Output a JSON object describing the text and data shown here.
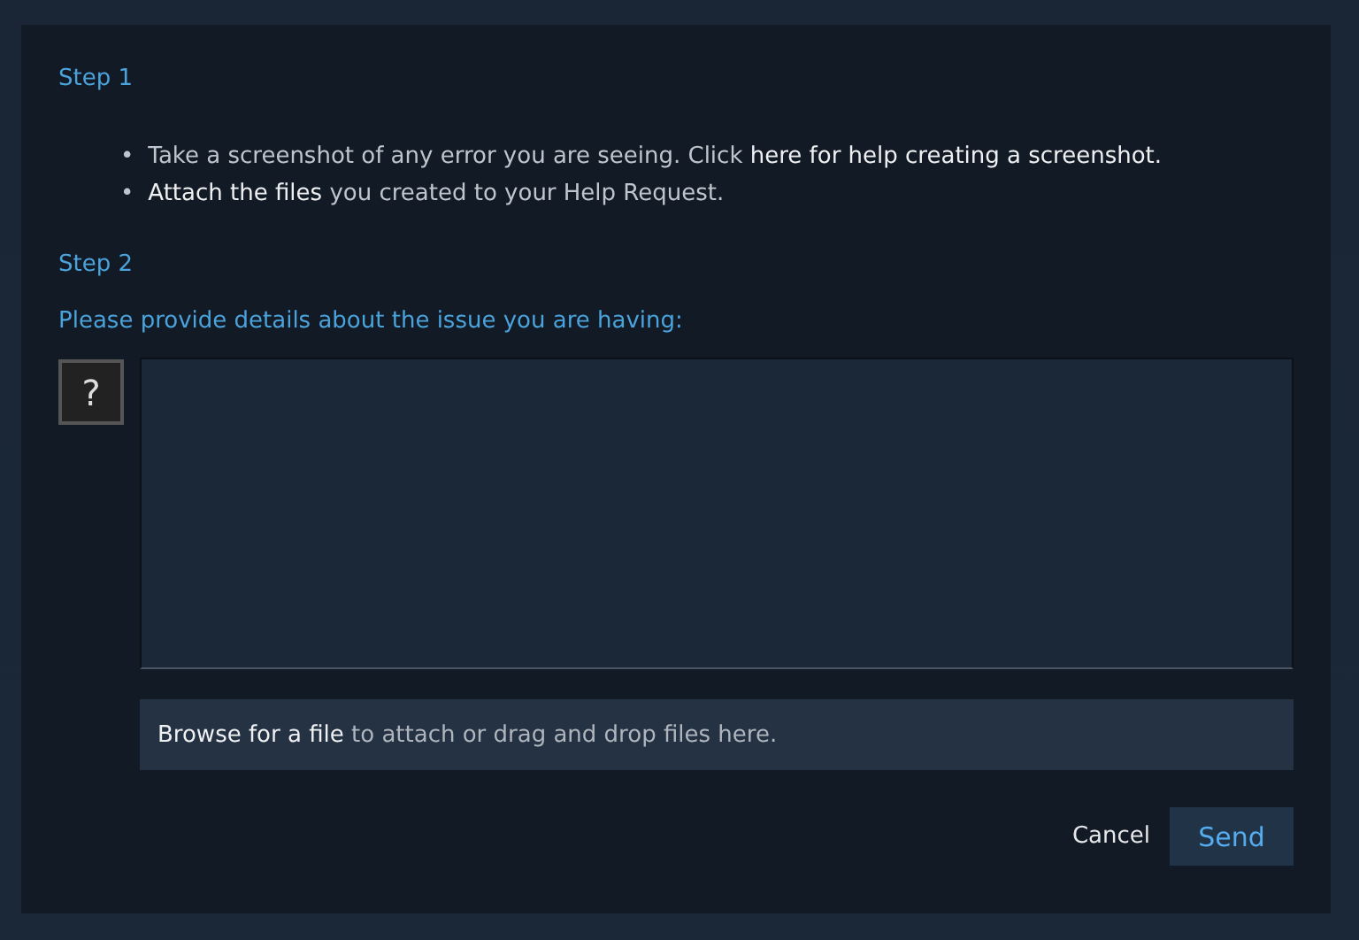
{
  "step1": {
    "heading": "Step 1",
    "bullets": [
      {
        "marker": "•",
        "parts": [
          {
            "kind": "plain",
            "text": "Take a screenshot of any error you are seeing. Click "
          },
          {
            "kind": "link",
            "text": "here for help creating a screenshot."
          }
        ]
      },
      {
        "marker": "•",
        "parts": [
          {
            "kind": "link",
            "text": "Attach the files"
          },
          {
            "kind": "plain",
            "text": " you created to your Help Request."
          }
        ]
      }
    ]
  },
  "step2": {
    "heading": "Step 2",
    "prompt": "Please provide details about the issue you are having:",
    "help_button": "?",
    "drop_zone": {
      "parts": [
        {
          "kind": "link",
          "text": "Browse for a file"
        },
        {
          "kind": "plain",
          "text": " to attach or drag and drop files here."
        }
      ]
    }
  },
  "buttons": [
    {
      "kind": "cancel",
      "label": "Cancel"
    },
    {
      "kind": "send",
      "label": "Send"
    }
  ]
}
